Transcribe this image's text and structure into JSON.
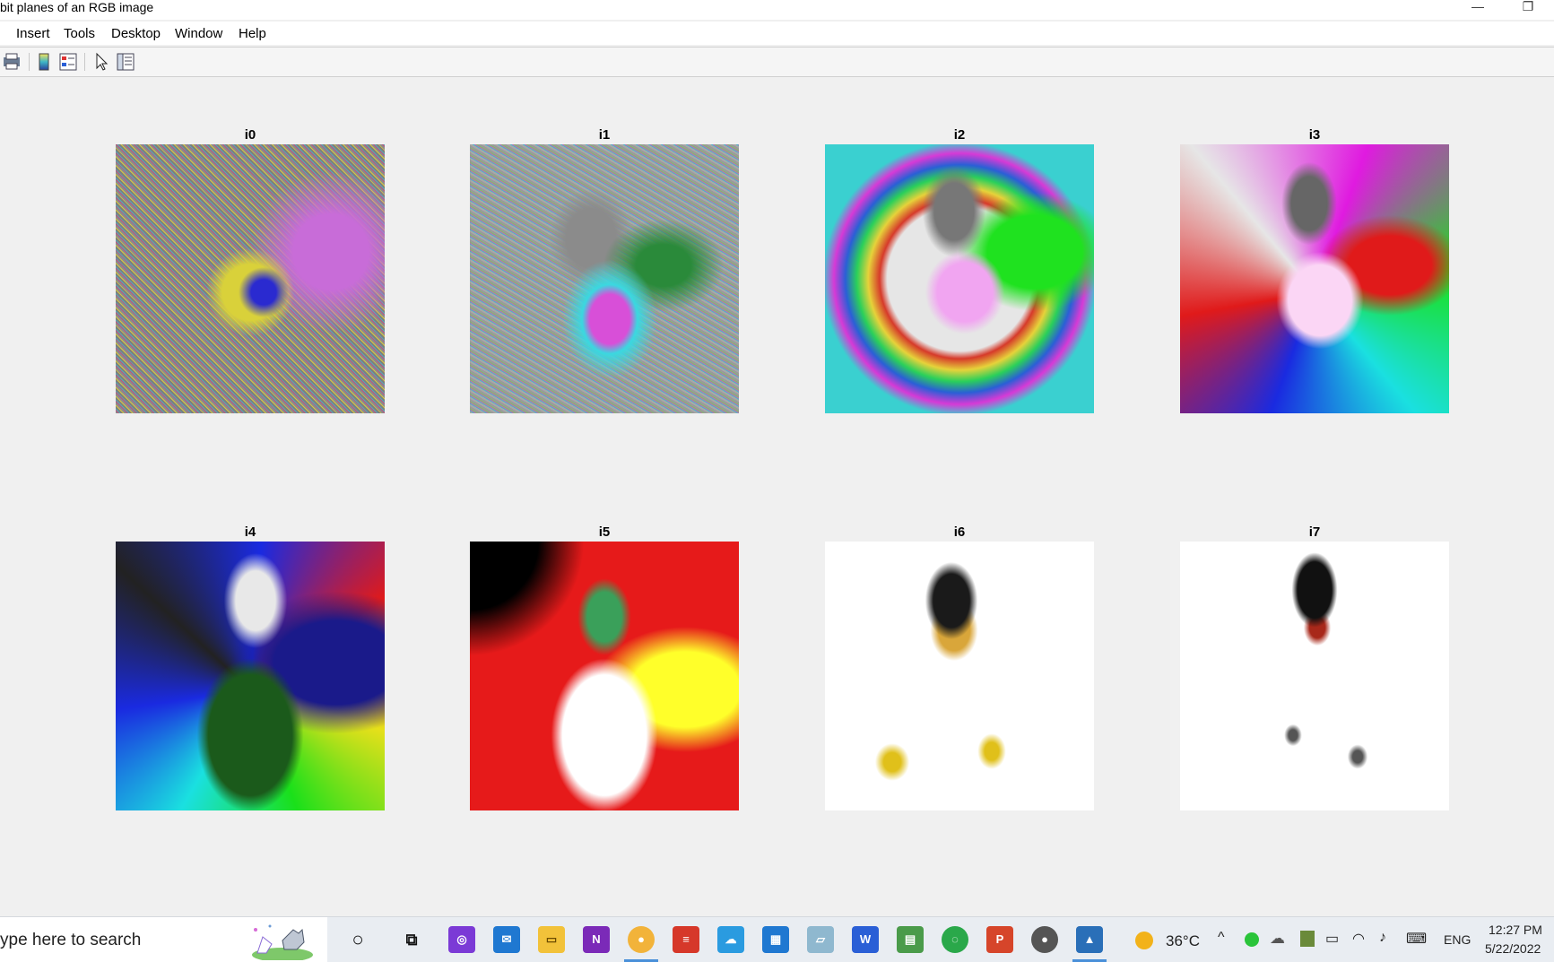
{
  "window": {
    "title": "bit planes of an RGB image",
    "minimize_glyph": "—",
    "restore_glyph": "❐"
  },
  "menu": [
    {
      "label": "Insert"
    },
    {
      "label": "Tools"
    },
    {
      "label": "Desktop"
    },
    {
      "label": "Window"
    },
    {
      "label": "Help"
    }
  ],
  "toolbar": {
    "icons": [
      "print-figure-icon",
      "insert-colorbar-icon",
      "insert-legend-icon",
      "edit-plot-pointer-icon",
      "property-inspector-icon"
    ]
  },
  "planes": [
    {
      "title": "i0"
    },
    {
      "title": "i1"
    },
    {
      "title": "i2"
    },
    {
      "title": "i3"
    },
    {
      "title": "i4"
    },
    {
      "title": "i5"
    },
    {
      "title": "i6"
    },
    {
      "title": "i7"
    }
  ],
  "taskbar": {
    "search_placeholder": "ype here to search",
    "apps": [
      "cortana-icon",
      "task-view-icon",
      "app-icon-1",
      "mail-icon",
      "file-explorer-icon",
      "onenote-icon",
      "chrome-icon",
      "todoist-icon",
      "onedrive-icon",
      "calendar-icon",
      "notes-icon",
      "word-icon",
      "excel-icon",
      "refresh-app-icon",
      "powerpoint-icon",
      "app-circle-icon",
      "matlab-icon"
    ],
    "weather": "36°C",
    "language": "ENG",
    "time": "12:27 PM",
    "date": "5/22/2022"
  },
  "colors": {
    "figure_bg": "#f0f0f0",
    "taskbar_bg": "#e9edf2"
  }
}
